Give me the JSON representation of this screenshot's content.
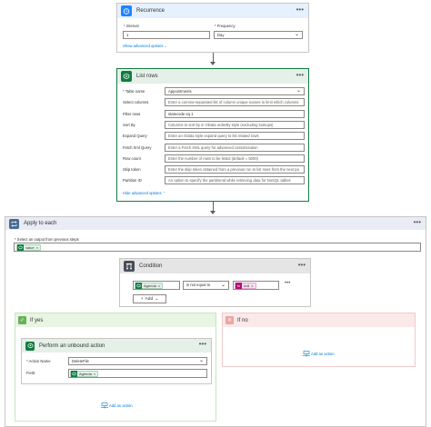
{
  "recurrence": {
    "title": "Recurrence",
    "interval_label": "* Interval",
    "interval_value": "1",
    "frequency_label": "* Frequency",
    "frequency_value": "Day",
    "show_advanced": "Show advanced options"
  },
  "list_rows": {
    "title": "List rows",
    "fields": [
      {
        "label": "* Table name",
        "value": "Appointments",
        "is_placeholder": false,
        "dropdown": true
      },
      {
        "label": "Select columns",
        "value": "Enter a comma-separated list of column unique names to limit which columns",
        "is_placeholder": true
      },
      {
        "label": "Filter rows",
        "value": "statecode eq 1",
        "is_placeholder": false
      },
      {
        "label": "Sort By",
        "value": "Columns to sort by in OData orderBy style (excluding lookups)",
        "is_placeholder": true
      },
      {
        "label": "Expand Query",
        "value": "Enter an Odata style expand query to list related rows",
        "is_placeholder": true
      },
      {
        "label": "Fetch Xml Query",
        "value": "Enter a Fetch XML query for advanced customization",
        "is_placeholder": true
      },
      {
        "label": "Row count",
        "value": "Enter the number of rows to be listed (default = 5000)",
        "is_placeholder": true
      },
      {
        "label": "Skip token",
        "value": "Enter the skip token obtained from a previous run to list rows from the next pa",
        "is_placeholder": true
      },
      {
        "label": "Partition ID",
        "value": "An option to specify the partitionId while retrieving data for NoSQL tables",
        "is_placeholder": true
      }
    ],
    "hide_advanced": "Hide advanced options"
  },
  "apply_each": {
    "title": "Apply to each",
    "select_label": "* Select an output from previous steps",
    "token": "value"
  },
  "condition": {
    "title": "Condition",
    "left_token": "Agenda",
    "operator": "is not equal to",
    "right_token": "null",
    "add_label": "Add"
  },
  "if_yes": {
    "title": "If yes",
    "action_title": "Perform an unbound action",
    "action_name_label": "* Action Name",
    "action_name_value": "DeleteFile",
    "field_label": "Field",
    "field_token": "Agenda",
    "add_action": "Add an action"
  },
  "if_no": {
    "title": "If no",
    "add_action": "Add an action"
  },
  "colors": {
    "recurrence_accent": "#1f85ff",
    "dataverse_accent": "#107c41",
    "apply_each_header": "#e8ecf4",
    "condition_header": "#e5e5e5",
    "yes_header": "#e8f5e2",
    "no_header": "#fbe9e9",
    "expression_token": "#b8097d"
  }
}
